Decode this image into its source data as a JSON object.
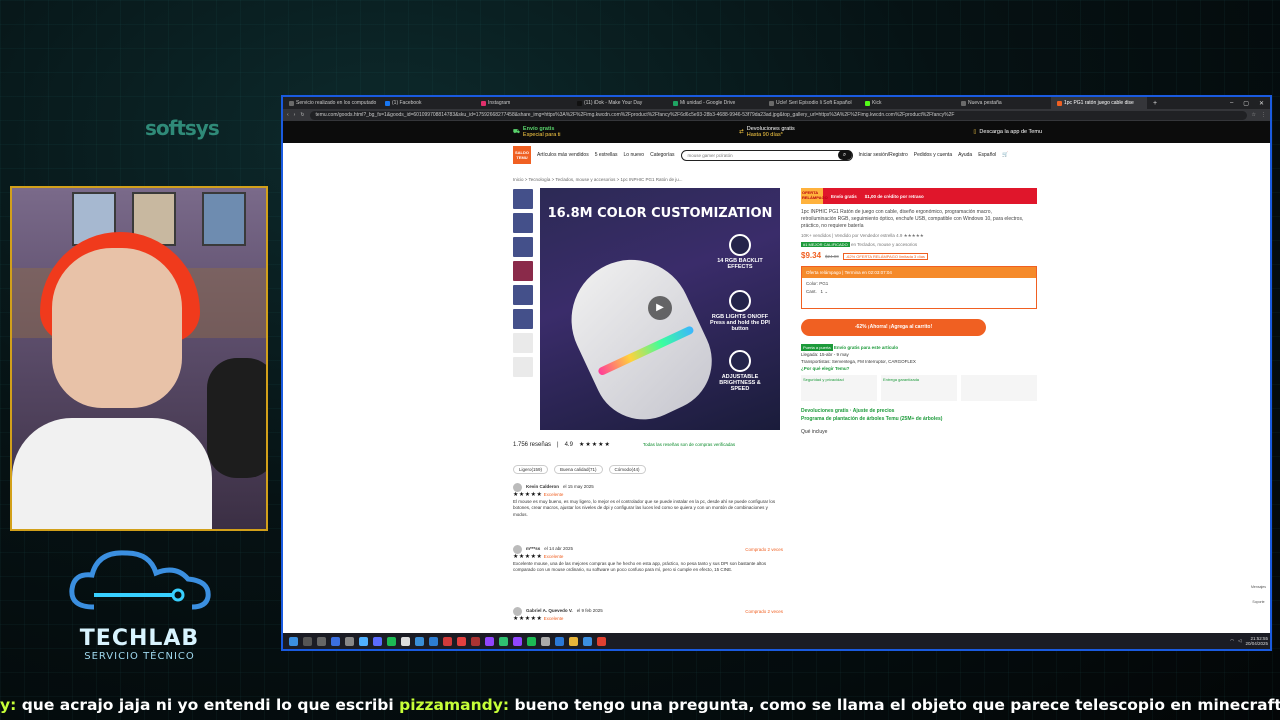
{
  "overlay": {
    "brand_top": "softsys",
    "logo_title": "TECHLAB",
    "logo_subtitle": "SERVICIO TÉCNICO",
    "chat": {
      "prefix": "y:",
      "msg1": " que acrajo jaja ni yo entendi lo que escribi ",
      "user2": "pizzamandy:",
      "msg2": " bueno tengo una pregunta, como se llama el objeto que parece telescopio en minecraft vanilla"
    }
  },
  "browser": {
    "tabs": [
      {
        "label": "Servicio realizado en los computado"
      },
      {
        "label": "(1) Facebook"
      },
      {
        "label": "Instagram"
      },
      {
        "label": "(11) iDok - Make Your Day"
      },
      {
        "label": "Mi unidad - Google Drive"
      },
      {
        "label": "Ucle! Seri Episodio li Soft Español"
      },
      {
        "label": "Kick"
      },
      {
        "label": "Nueva pestaña"
      },
      {
        "label": "1pc PG1 ratón juego cable dise"
      }
    ],
    "url": "temu.com/goods.html?_bg_fs=1&goods_id=601099708814783&sku_id=17592668277458&share_img=https%3A%2F%2Fimg.kwcdn.com%2Fproduct%2Ffancy%2F6d6c5e93-28b3-4688-9946-53f79da23ad.jpg&top_gallery_url=https%3A%2F%2Fimg.kwcdn.com%2Fproduct%2Ffancy%2F"
  },
  "temu": {
    "banner": [
      {
        "title": "Envío gratis",
        "sub": "Especial para ti"
      },
      {
        "title": "Devoluciones gratis",
        "sub": "Hasta 90 días*"
      },
      {
        "title": "Descarga la app de Temu",
        "sub": ""
      }
    ],
    "logo": "SALDO TEMU",
    "nav": [
      "Artículos más vendidos",
      "5 estrellas",
      "Lo nuevo",
      "Categorías"
    ],
    "search_placeholder": "mouse gamer pc/ratón",
    "account": [
      "Iniciar sesión/Registro",
      "Pedidos y cuenta",
      "Ayuda",
      "Español"
    ],
    "breadcrumb": "Inicio  >  Tecnología  >  Teclados, mouse y accesorios  >  1pc INPHIC PG1 Ratón de ju...",
    "image": {
      "headline": "16.8M COLOR CUSTOMIZATION",
      "features": [
        "14 RGB BACKLIT EFFECTS",
        "RGB LIGHTS ON/OFF Press and hold the DPI button",
        "ADJUSTABLE BRIGHTNESS & SPEED"
      ]
    },
    "reviews": {
      "count": "1.756 reseñas",
      "rating": "4.9",
      "stars": "★★★★★",
      "verified": "Todas las reseñas son de compras verificadas",
      "chips": [
        "Ligero(159)",
        "Buena calidad(71)",
        "Cómodo(44)"
      ],
      "items": [
        {
          "name": "Kevin Calderon",
          "date": "el 15 may 2025",
          "stars": "★★★★★",
          "label": "Excelente",
          "text": "El mouse es muy bueno, es muy ligero, lo mejor es el controlador que se puede instalar en la pc, desde ahí se puede configurar los botones, crear macros, ajustar los niveles de dpi y configurar las luces led como se quiera y con un montón de combinaciones y modos.",
          "purchased": ""
        },
        {
          "name": "m***ss",
          "date": "el 14 abr 2025",
          "stars": "★★★★★",
          "label": "Excelente",
          "text": "Excelente mouse, una de las mejores compras que he hecho en esta app, práctico, no pesa tanto y sus DPI son bastante altos comparado con un mouse ordinario, su software un poco confuso para mí, pero si cumple en efecto, 15 CINE.",
          "purchased": "Comprado 2 veces"
        },
        {
          "name": "Gabriel A. Quevedo V.",
          "date": "el 9 feb 2025",
          "stars": "★★★★★",
          "label": "Excelente",
          "text": "",
          "purchased": "Comprado 2 veces"
        }
      ]
    },
    "product": {
      "promo_label": "OFERTA RELÁMPAGO",
      "promo_items": [
        "Envío gratis",
        "$1,00 de crédito por retraso"
      ],
      "title": "1pc INPHIC PG1 Ratón de juego con cable, diseño ergonómico, programación macro, retroiluminación RGB, seguimiento óptico, enchufe USB, compatible con Windows 10, para electros, práctico, no requiere batería",
      "meta": "10K+ vendidos  |  Vendido por  Vendedor estrella   4.9 ★★★★★",
      "badge": "#1 MEJOR CALIFICADO",
      "badge_sub": "en Teclados, mouse y accesorios",
      "price": "$9.34",
      "old_price": "$24.90",
      "discount": "-62% OFERTA RELÁMPAGO limitada 3 días",
      "offer_bar": "Oferta relámpago  |  Termina en 02:03:07:04",
      "color_label": "Color: PG1",
      "qty_label": "Cant.",
      "qty_value": "1",
      "add_to_cart": "-62% ¡Ahorra! ¡Agrega al carrito!",
      "ship_badge": "Puerta a puerta",
      "ship_text": "Envío gratis para este artículo",
      "delivery": "Llegada: 15-abr - 9 may",
      "carrier": "Transportistas: Serventega, FM Interruptor, CARGOFLEX",
      "why": "¿Por qué elegir Temu?",
      "why_cols": [
        "Seguridad y privacidad",
        "Entrega garantizada",
        ""
      ],
      "returns": "Devoluciones gratis · Ajuste de precios",
      "trees": "Programa de plantación de árboles Temu (25M+ de árboles)",
      "includes": "Qué incluye"
    },
    "side": [
      "Mensajes",
      "Soporte"
    ]
  },
  "taskbar": {
    "time": "21:52:55",
    "date": "20/04/2025"
  },
  "colors": {
    "temu_orange": "#f06022",
    "green": "#1c9a3a",
    "chat_user": "#c6ff38"
  }
}
